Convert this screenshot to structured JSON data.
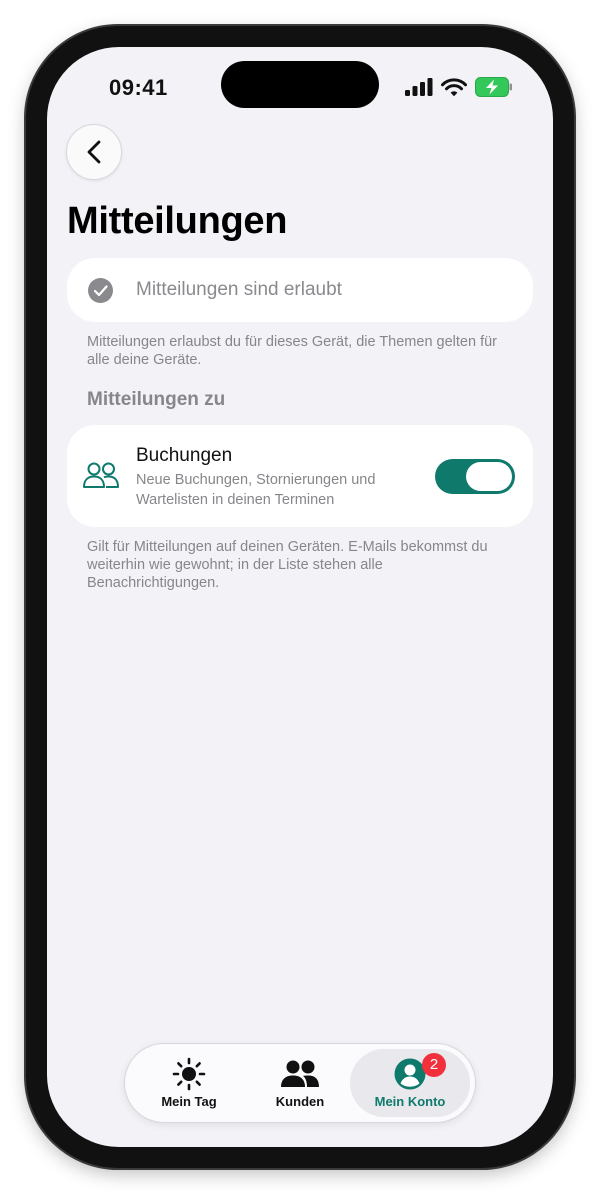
{
  "status_bar": {
    "time": "09:41"
  },
  "header": {
    "back_icon": "chevron-left-icon",
    "title": "Mitteilungen"
  },
  "permission": {
    "icon": "checkmark-circle-icon",
    "label": "Mitteilungen sind erlaubt",
    "note": "Mitteilungen erlaubst du für dieses Gerät, die Themen gelten für alle deine Geräte."
  },
  "section": {
    "header": "Mitteilungen zu"
  },
  "bookings": {
    "icon": "people-icon",
    "title": "Buchungen",
    "description": "Neue Buchungen, Stornierungen und Wartelisten in deinen Terminen",
    "enabled": true
  },
  "footer_note": "Gilt für Mitteilungen auf deinen Geräten. E-Mails bekommst du weiterhin wie gewohnt; in der Liste stehen alle Benachrichtigungen.",
  "tabbar": {
    "tabs": [
      {
        "label": "Mein Tag",
        "icon": "sun-icon"
      },
      {
        "label": "Kunden",
        "icon": "people-icon"
      },
      {
        "label": "Mein Konto",
        "icon": "person-circle-icon",
        "badge": "2",
        "active": true
      }
    ]
  },
  "colors": {
    "accent": "#0f7a6c",
    "background": "#f2f2f7",
    "badge": "#f2303c",
    "secondary_text": "#86868b"
  }
}
